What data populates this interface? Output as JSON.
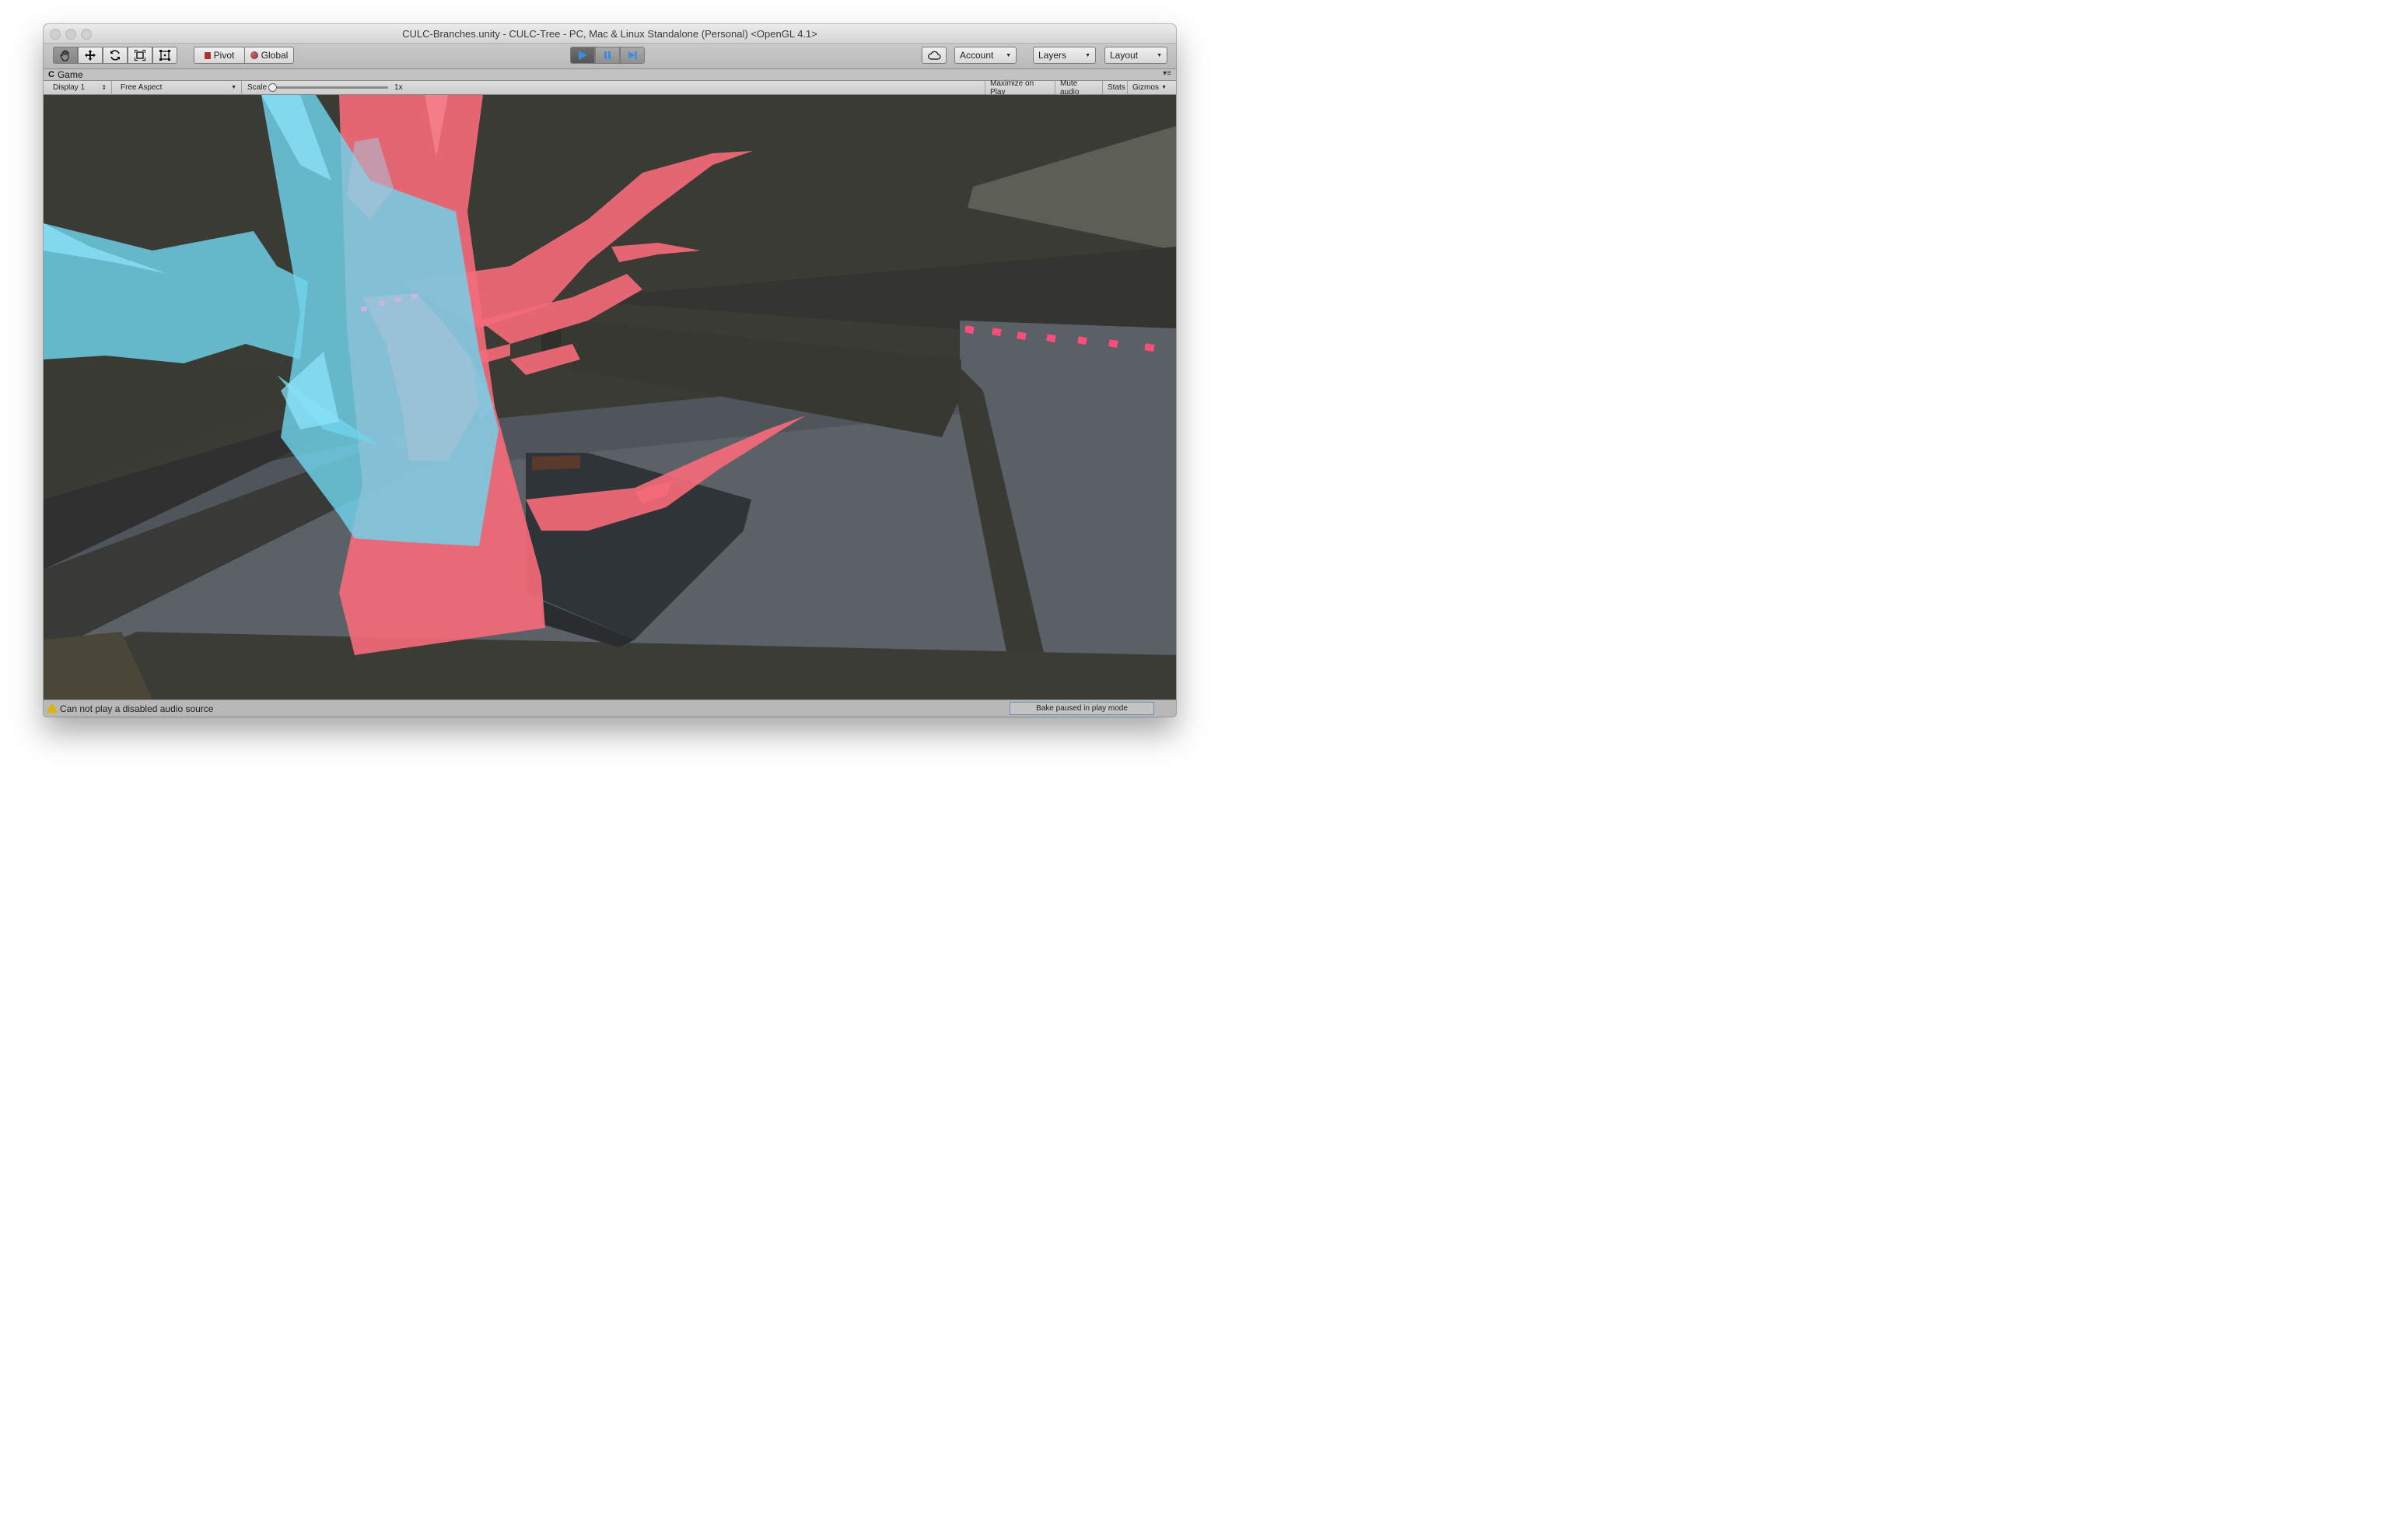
{
  "window": {
    "title": "CULC-Branches.unity - CULC-Tree - PC, Mac & Linux Standalone (Personal) <OpenGL 4.1>"
  },
  "toolbar": {
    "transform_tools": [
      "hand-tool",
      "move-tool",
      "rotate-tool",
      "scale-tool",
      "rect-tool"
    ],
    "pivot_label": "Pivot",
    "global_label": "Global",
    "play_controls": [
      "play",
      "pause",
      "step"
    ],
    "account_label": "Account",
    "layers_label": "Layers",
    "layout_label": "Layout"
  },
  "game_view": {
    "tab_label": "Game",
    "display_label": "Display 1",
    "aspect_label": "Free Aspect",
    "scale_label": "Scale",
    "scale_value": "1x",
    "maximize_label": "Maximize on Play",
    "mute_label": "Mute audio",
    "stats_label": "Stats",
    "gizmos_label": "Gizmos"
  },
  "status": {
    "message": "Can not play a disabled audio source",
    "bake": "Bake paused in play mode"
  },
  "colors": {
    "accent_play": "#3b8de0",
    "pink_tree": "#f46a78",
    "cyan_tree": "#6fd3ec",
    "scene_bg": "#3b3b36"
  }
}
